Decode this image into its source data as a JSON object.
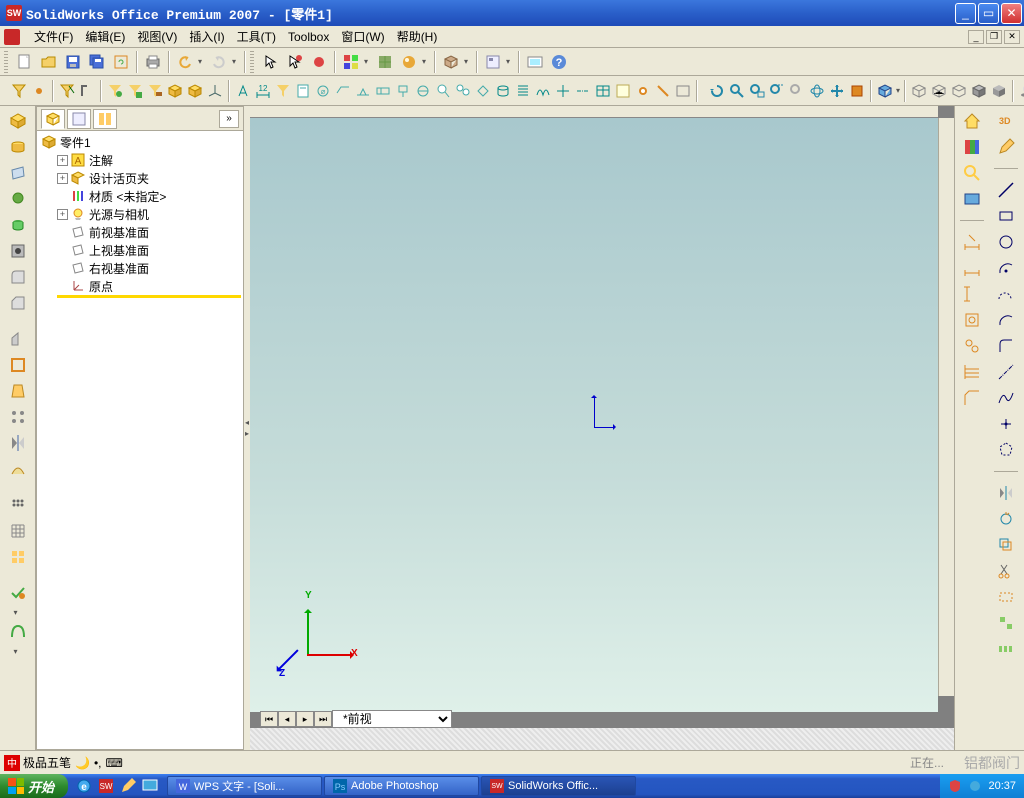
{
  "title": "SolidWorks Office Premium 2007 - [零件1]",
  "menus": {
    "file": "文件(F)",
    "edit": "编辑(E)",
    "view": "视图(V)",
    "insert": "插入(I)",
    "tool": "工具(T)",
    "toolbox": "Toolbox",
    "window": "窗口(W)",
    "help": "帮助(H)"
  },
  "tree": {
    "root": "零件1",
    "n1": "注解",
    "n2": "设计活页夹",
    "n3": "材质 <未指定>",
    "n4": "光源与相机",
    "n5": "前视基准面",
    "n6": "上视基准面",
    "n7": "右视基准面",
    "n8": "原点"
  },
  "view_select": "*前视",
  "triad": {
    "x": "X",
    "y": "Y",
    "z": "Z"
  },
  "status": {
    "ime": "极品五笔",
    "loading": "正在...",
    "watermark": "铝都阀门"
  },
  "taskbar": {
    "start": "开始",
    "items": [
      "WPS 文字 - [Soli...",
      "Adobe Photoshop",
      "SolidWorks Offic..."
    ],
    "time": "20:37"
  }
}
